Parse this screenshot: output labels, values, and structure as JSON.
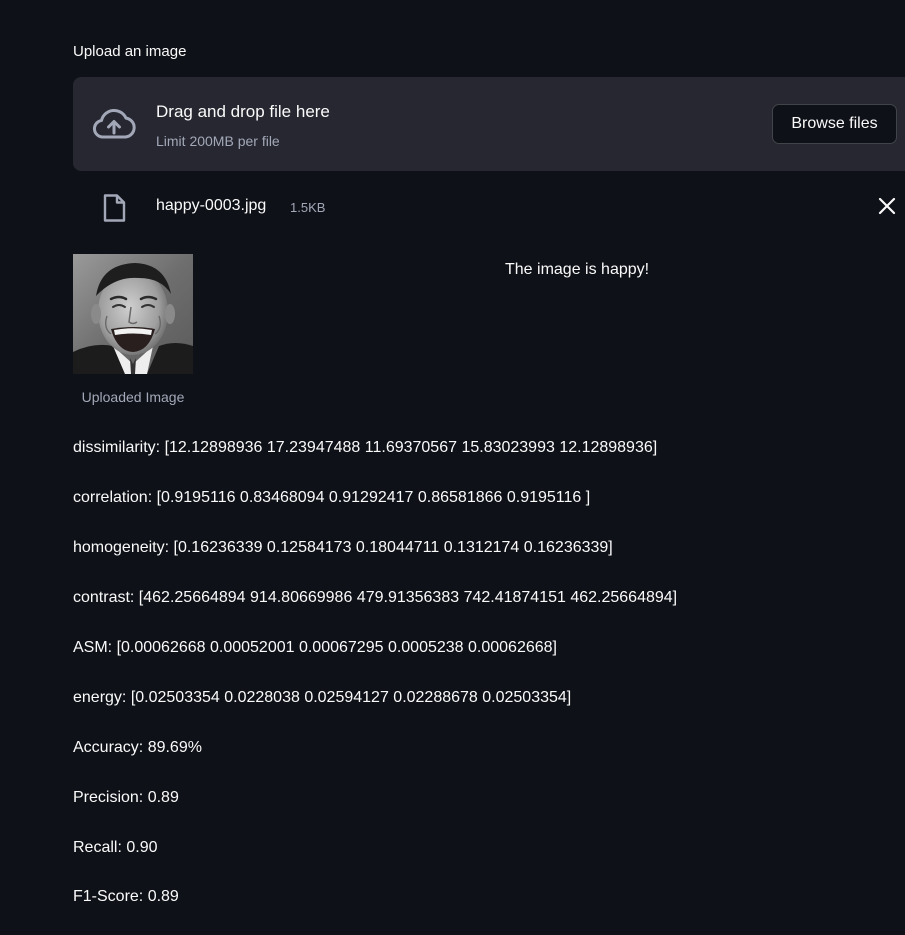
{
  "uploader": {
    "label": "Upload an image",
    "dropzone_title": "Drag and drop file here",
    "dropzone_limit": "Limit 200MB per file",
    "browse_label": "Browse files",
    "icon": "cloud-upload-icon"
  },
  "file": {
    "name": "happy-0003.jpg",
    "size": "1.5KB",
    "icon": "file-icon",
    "remove_icon": "close-icon"
  },
  "image": {
    "caption": "Uploaded Image"
  },
  "result": {
    "text": "The image is happy!"
  },
  "features": {
    "dissimilarity": "dissimilarity: [12.12898936 17.23947488 11.69370567 15.83023993 12.12898936]",
    "correlation": "correlation: [0.9195116 0.83468094 0.91292417 0.86581866 0.9195116 ]",
    "homogeneity": "homogeneity: [0.16236339 0.12584173 0.18044711 0.1312174 0.16236339]",
    "contrast": "contrast: [462.25664894 914.80669986 479.91356383 742.41874151 462.25664894]",
    "asm": "ASM: [0.00062668 0.00052001 0.00067295 0.0005238 0.00062668]",
    "energy": "energy: [0.02503354 0.0228038 0.02594127 0.02288678 0.02503354]"
  },
  "metrics": {
    "accuracy": "Accuracy: 89.69%",
    "precision": "Precision: 0.89",
    "recall": "Recall: 0.90",
    "f1": "F1-Score: 0.89"
  },
  "colors": {
    "background": "#0e1117",
    "dropzone": "#262730",
    "text": "#fafafa",
    "muted_text": "#a3a8b8"
  }
}
